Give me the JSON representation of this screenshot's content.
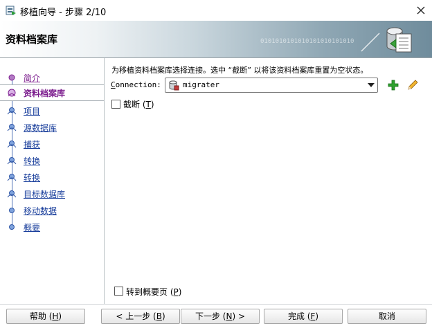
{
  "window": {
    "title": "移植向导 - 步骤 2/10",
    "close_label": "✕"
  },
  "banner": {
    "heading": "资料档案库",
    "decoration_text": "0101010101010101010101010"
  },
  "steps": [
    {
      "label": "简介",
      "state": "visited"
    },
    {
      "label": "资料档案库",
      "state": "current"
    },
    {
      "label": "项目",
      "state": "pending"
    },
    {
      "label": "源数据库",
      "state": "pending"
    },
    {
      "label": "捕获 ",
      "state": "pending"
    },
    {
      "label": "转换",
      "state": "pending"
    },
    {
      "label": "转换",
      "state": "pending"
    },
    {
      "label": "目标数据库",
      "state": "pending"
    },
    {
      "label": "移动数据",
      "state": "pending"
    },
    {
      "label": "概要",
      "state": "pending"
    }
  ],
  "content": {
    "instruction": "为移植资料档案库选择连接。选中 “截断” 以将该资料档案库重置为空状态。",
    "connection_label_pre": "C",
    "connection_label_post": "onnection:",
    "connection_value": "migrater",
    "truncate_label_pre": "截断 (",
    "truncate_mnemonic": "T",
    "truncate_label_post": ")",
    "truncate_checked": false,
    "goto_summary_label_pre": "转到概要页 (",
    "goto_summary_mnemonic": "P",
    "goto_summary_label_post": ")",
    "goto_summary_checked": false
  },
  "buttons": {
    "help": {
      "pre": "帮助 (",
      "mn": "H",
      "post": ")"
    },
    "back": {
      "pre": "< 上一步 (",
      "mn": "B",
      "post": ")"
    },
    "next": {
      "pre": "下一步 (",
      "mn": "N",
      "post": ") >"
    },
    "finish": {
      "pre": "完成 (",
      "mn": "F",
      "post": ")"
    },
    "cancel": {
      "label": "取消"
    }
  },
  "colors": {
    "link": "#1a3f9c",
    "visited_link": "#7b1b8d",
    "add_icon": "#2ea12e",
    "edit_icon": "#d9a21b"
  }
}
